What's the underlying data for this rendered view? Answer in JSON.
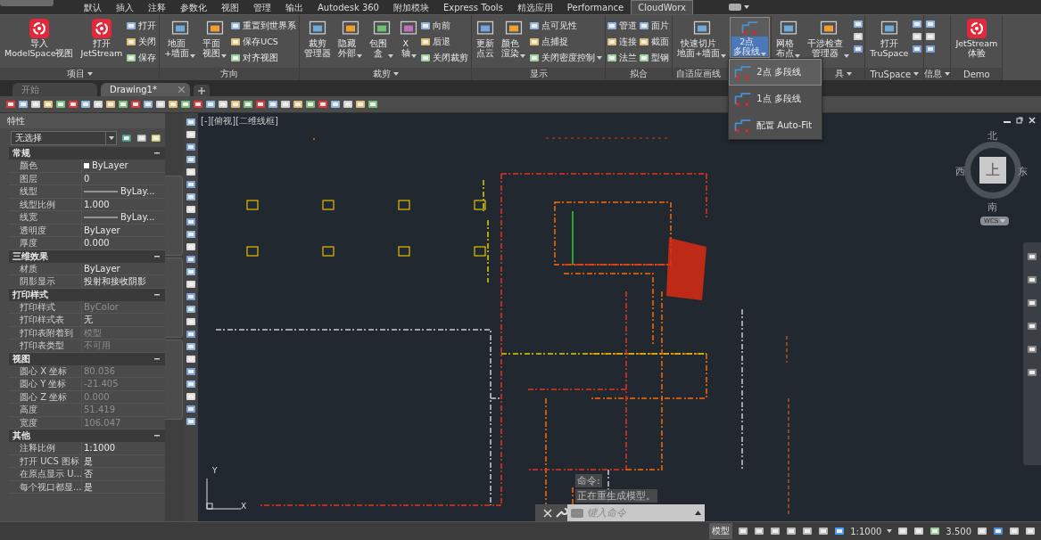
{
  "menu_tabs": [
    {
      "label": "默认",
      "selected": false
    },
    {
      "label": "插入",
      "selected": false
    },
    {
      "label": "注释",
      "selected": false
    },
    {
      "label": "参数化",
      "selected": false
    },
    {
      "label": "视图",
      "selected": false
    },
    {
      "label": "管理",
      "selected": false
    },
    {
      "label": "输出",
      "selected": false
    },
    {
      "label": "Autodesk 360",
      "selected": false
    },
    {
      "label": "附加模块",
      "selected": false
    },
    {
      "label": "Express Tools",
      "selected": false
    },
    {
      "label": "精选应用",
      "selected": false
    },
    {
      "label": "Performance",
      "selected": false
    },
    {
      "label": "CloudWorx",
      "selected": true
    }
  ],
  "ribbon_panels": [
    {
      "title": "项目",
      "has_menu": true,
      "groups": [
        {
          "kind": "logo",
          "lines": [
            "导入",
            "ModelSpace视图"
          ]
        },
        {
          "kind": "logo",
          "lines": [
            "打开",
            "JetStream"
          ]
        },
        {
          "kind": "stack",
          "items": [
            {
              "label": "打开",
              "has_menu": false
            },
            {
              "label": "关闭",
              "has_menu": false
            },
            {
              "label": "保存",
              "has_menu": false
            }
          ]
        }
      ]
    },
    {
      "title": "方向",
      "has_menu": false,
      "groups": [
        {
          "kind": "large",
          "lines": [
            "地面",
            "+墙面"
          ],
          "has_menu": true,
          "selected": false
        },
        {
          "kind": "large",
          "lines": [
            "平面",
            "视图"
          ],
          "has_menu": true,
          "selected": false
        },
        {
          "kind": "stack",
          "items": [
            {
              "label": "重置到世界系",
              "has_menu": false
            },
            {
              "label": "保存UCS",
              "has_menu": false
            },
            {
              "label": "对齐视图",
              "has_menu": false
            }
          ]
        }
      ]
    },
    {
      "title": "裁剪",
      "has_menu": true,
      "groups": [
        {
          "kind": "large",
          "lines": [
            "裁剪",
            "管理器"
          ],
          "has_menu": false,
          "selected": false
        },
        {
          "kind": "large",
          "lines": [
            "隐藏",
            "外部"
          ],
          "has_menu": true,
          "selected": false
        },
        {
          "kind": "large",
          "lines": [
            "包围",
            "盒"
          ],
          "has_menu": true,
          "selected": false
        },
        {
          "kind": "large",
          "lines": [
            "X",
            "轴"
          ],
          "has_menu": true,
          "selected": false
        },
        {
          "kind": "stack",
          "items": [
            {
              "label": "向前",
              "has_menu": false
            },
            {
              "label": "后退",
              "has_menu": false
            },
            {
              "label": "关闭裁剪",
              "has_menu": false
            }
          ]
        }
      ]
    },
    {
      "title": "显示",
      "has_menu": false,
      "groups": [
        {
          "kind": "large",
          "lines": [
            "更新",
            "点云"
          ],
          "has_menu": false,
          "selected": false
        },
        {
          "kind": "large",
          "lines": [
            "颜色",
            "渲染"
          ],
          "has_menu": true,
          "selected": false
        },
        {
          "kind": "stack",
          "items": [
            {
              "label": "点可见性",
              "has_menu": false
            },
            {
              "label": "点捕捉",
              "has_menu": false
            },
            {
              "label": "关闭密度控制",
              "has_menu": true
            }
          ]
        }
      ]
    },
    {
      "title": "拟合",
      "has_menu": false,
      "groups": [
        {
          "kind": "stack",
          "items": [
            {
              "label": "管道",
              "has_menu": false
            },
            {
              "label": "连接",
              "has_menu": false
            },
            {
              "label": "法兰",
              "has_menu": false
            }
          ]
        },
        {
          "kind": "stack",
          "items": [
            {
              "label": "面片",
              "has_menu": false
            },
            {
              "label": "截面",
              "has_menu": false
            },
            {
              "label": "型钢",
              "has_menu": false
            }
          ]
        }
      ]
    },
    {
      "title": "自适应画线",
      "has_menu": false,
      "groups": [
        {
          "kind": "large",
          "lines": [
            "快速切片",
            "地面+墙面"
          ],
          "has_menu": true,
          "selected": false
        },
        {
          "kind": "large",
          "lines": [
            "2点",
            "多段线"
          ],
          "has_menu": true,
          "selected": true
        }
      ]
    },
    {
      "title": "具",
      "has_menu": true,
      "groups": [
        {
          "kind": "large",
          "lines": [
            "网格",
            "布点"
          ],
          "has_menu": true,
          "selected": false
        },
        {
          "kind": "large",
          "lines": [
            "干涉检查",
            "管理器"
          ],
          "has_menu": true,
          "selected": false
        },
        {
          "kind": "icons"
        }
      ]
    },
    {
      "title": "TruSpace",
      "has_menu": true,
      "groups": [
        {
          "kind": "large",
          "lines": [
            "打开",
            "TruSpace"
          ],
          "has_menu": false,
          "selected": false
        },
        {
          "kind": "icons"
        }
      ]
    },
    {
      "title": "信息",
      "has_menu": true,
      "groups": [
        {
          "kind": "icons"
        }
      ]
    },
    {
      "title": "Demo",
      "has_menu": false,
      "groups": [
        {
          "kind": "logo",
          "lines": [
            "JetStream",
            "体验"
          ]
        }
      ]
    }
  ],
  "dropdown_menu": [
    {
      "label": "2点 多段线",
      "selected": true
    },
    {
      "label": "1点 多段线",
      "selected": false
    },
    {
      "label": "配置 Auto-Fit",
      "selected": false
    }
  ],
  "file_tabs": [
    {
      "label": "开始",
      "selected": false
    },
    {
      "label": "Drawing1*",
      "selected": true
    }
  ],
  "properties": {
    "title": "特性",
    "selection": "无选择",
    "sections": [
      {
        "title": "常规",
        "rows": [
          {
            "label": "颜色",
            "value": "ByLayer",
            "kind": "color",
            "disabled": false
          },
          {
            "label": "图层",
            "value": "0",
            "kind": "text",
            "disabled": false
          },
          {
            "label": "线型",
            "value": "ByLay...",
            "kind": "line",
            "disabled": false
          },
          {
            "label": "线型比例",
            "value": "1.000",
            "kind": "text",
            "disabled": false
          },
          {
            "label": "线宽",
            "value": "ByLay...",
            "kind": "line",
            "disabled": false
          },
          {
            "label": "透明度",
            "value": "ByLayer",
            "kind": "text",
            "disabled": false
          },
          {
            "label": "厚度",
            "value": "0.000",
            "kind": "text",
            "disabled": false
          }
        ]
      },
      {
        "title": "三维效果",
        "rows": [
          {
            "label": "材质",
            "value": "ByLayer",
            "kind": "text",
            "disabled": false
          },
          {
            "label": "阴影显示",
            "value": "投射和接收阴影",
            "kind": "text",
            "disabled": false
          }
        ]
      },
      {
        "title": "打印样式",
        "rows": [
          {
            "label": "打印样式",
            "value": "ByColor",
            "kind": "text",
            "disabled": true
          },
          {
            "label": "打印样式表",
            "value": "无",
            "kind": "text",
            "disabled": false
          },
          {
            "label": "打印表附着到",
            "value": "模型",
            "kind": "text",
            "disabled": true
          },
          {
            "label": "打印表类型",
            "value": "不可用",
            "kind": "text",
            "disabled": true
          }
        ]
      },
      {
        "title": "视图",
        "rows": [
          {
            "label": "圆心 X 坐标",
            "value": "80.036",
            "kind": "text",
            "disabled": true
          },
          {
            "label": "圆心 Y 坐标",
            "value": "-21.405",
            "kind": "text",
            "disabled": true
          },
          {
            "label": "圆心 Z 坐标",
            "value": "0.000",
            "kind": "text",
            "disabled": true
          },
          {
            "label": "高度",
            "value": "51.419",
            "kind": "text",
            "disabled": true
          },
          {
            "label": "宽度",
            "value": "106.047",
            "kind": "text",
            "disabled": true
          }
        ]
      },
      {
        "title": "其他",
        "rows": [
          {
            "label": "注释比例",
            "value": "1:1000",
            "kind": "text",
            "disabled": false
          },
          {
            "label": "打开 UCS 图标",
            "value": "是",
            "kind": "text",
            "disabled": false
          },
          {
            "label": "在原点显示 U...",
            "value": "否",
            "kind": "text",
            "disabled": false
          },
          {
            "label": "每个视口都显...",
            "value": "是",
            "kind": "text",
            "disabled": false
          }
        ]
      }
    ]
  },
  "viewport": {
    "label": "[-][俯视][二维线框]",
    "viewcube": {
      "north": "北",
      "south": "南",
      "east": "东",
      "west": "西",
      "face": "上",
      "wcs": "WCS"
    },
    "ucs": {
      "x": "X",
      "y": "Y"
    }
  },
  "command_line": {
    "history": [
      "命令:",
      "正在重生成模型。"
    ],
    "placeholder": "键入命令"
  },
  "status_bar": {
    "model": "模型",
    "scale": "1:1000",
    "value": "3.500"
  }
}
